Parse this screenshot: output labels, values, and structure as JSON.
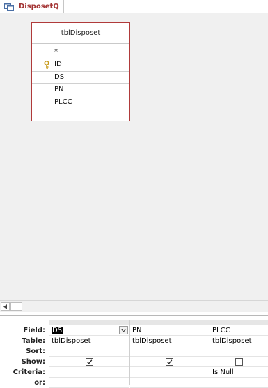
{
  "tab": {
    "label": "DisposetQ",
    "icon": "query-icon"
  },
  "table": {
    "title": "tblDisposet",
    "fields": [
      {
        "label": "*"
      },
      {
        "label": "ID",
        "icon": "primary-key-icon"
      },
      {
        "label": "DS"
      },
      {
        "label": "PN"
      },
      {
        "label": "PLCC"
      }
    ]
  },
  "grid": {
    "row_labels": [
      "Field:",
      "Table:",
      "Sort:",
      "Show:",
      "Criteria:",
      "or:"
    ],
    "columns": [
      {
        "field": "DS",
        "table": "tblDisposet",
        "sort": "",
        "show": true,
        "criteria": ""
      },
      {
        "field": "PN",
        "table": "tblDisposet",
        "sort": "",
        "show": true,
        "criteria": ""
      },
      {
        "field": "PLCC",
        "table": "tblDisposet",
        "sort": "",
        "show": false,
        "criteria": "Is Null"
      }
    ]
  },
  "colors": {
    "tab_text": "#a33333",
    "table_border": "#b03a3a",
    "design_bg": "#f0f0f0"
  }
}
